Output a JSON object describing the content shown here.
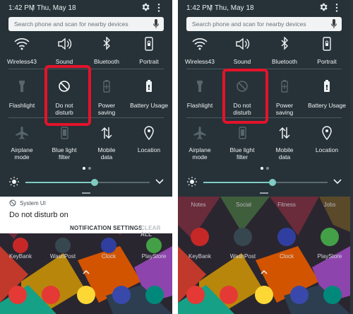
{
  "colors": {
    "panel": "#263238",
    "accent": "#80cbc4",
    "highlight": "#e3132a",
    "notification_bg": "#ffffff"
  },
  "screens": [
    {
      "status": {
        "time": "1:42 PM",
        "separator": "|",
        "date": "Thu, May 18"
      },
      "search": {
        "placeholder": "Search phone and scan for nearby devices"
      },
      "tiles": [
        {
          "label_lines": [
            "Wireless43",
            ""
          ],
          "icon": "wifi-icon"
        },
        {
          "label_lines": [
            "Sound",
            ""
          ],
          "icon": "volume-icon"
        },
        {
          "label_lines": [
            "Bluetooth",
            ""
          ],
          "icon": "bluetooth-icon"
        },
        {
          "label_lines": [
            "Portrait",
            ""
          ],
          "icon": "portrait-lock-icon"
        },
        {
          "label_lines": [
            "Flashlight",
            ""
          ],
          "icon": "flashlight-icon"
        },
        {
          "label_lines": [
            "Do not",
            "disturb"
          ],
          "icon": "do-not-disturb-icon"
        },
        {
          "label_lines": [
            "Power",
            "saving"
          ],
          "icon": "battery-saver-icon"
        },
        {
          "label_lines": [
            "Battery Usage",
            ""
          ],
          "icon": "battery-icon"
        },
        {
          "label_lines": [
            "Airplane",
            "mode"
          ],
          "icon": "airplane-icon"
        },
        {
          "label_lines": [
            "Blue light",
            "filter"
          ],
          "icon": "phone-icon"
        },
        {
          "label_lines": [
            "Mobile",
            "data"
          ],
          "icon": "mobile-data-icon"
        },
        {
          "label_lines": [
            "Location",
            ""
          ],
          "icon": "location-icon"
        }
      ],
      "dnd_state": "on",
      "page_indicator": {
        "pages": 2,
        "current": 1
      },
      "brightness_level": 0.58,
      "notification": {
        "app_name": "System UI",
        "title": "Do not disturb on",
        "action_primary": "NOTIFICATION SETTINGS",
        "action_secondary": "CLEAR ALL"
      },
      "apps": [
        {
          "label": "KeyBank",
          "color": "#c62828"
        },
        {
          "label": "WashPost",
          "color": "#37474f"
        },
        {
          "label": "Clock",
          "color": "#303f9f"
        },
        {
          "label": "PlayStore",
          "color": "#43a047"
        }
      ],
      "dock": [
        {
          "icon": "camera-icon",
          "color": "#e53935"
        },
        {
          "icon": "pocketcasts-icon",
          "color": "#e53935"
        },
        {
          "icon": "snapchat-icon",
          "color": "#fdd835"
        },
        {
          "icon": "browser-icon",
          "color": "#3949ab"
        },
        {
          "icon": "slides-icon",
          "color": "#00897b"
        }
      ]
    },
    {
      "status": {
        "time": "1:42 PM",
        "separator": "|",
        "date": "Thu, May 18"
      },
      "search": {
        "placeholder": "Search phone and scan for nearby devices"
      },
      "tiles": [
        {
          "label_lines": [
            "Wireless43",
            ""
          ],
          "icon": "wifi-icon"
        },
        {
          "label_lines": [
            "Sound",
            ""
          ],
          "icon": "volume-icon"
        },
        {
          "label_lines": [
            "Bluetooth",
            ""
          ],
          "icon": "bluetooth-icon"
        },
        {
          "label_lines": [
            "Portrait",
            ""
          ],
          "icon": "portrait-lock-icon"
        },
        {
          "label_lines": [
            "Flashlight",
            ""
          ],
          "icon": "flashlight-icon"
        },
        {
          "label_lines": [
            "Do not",
            "disturb"
          ],
          "icon": "do-not-disturb-icon"
        },
        {
          "label_lines": [
            "Power",
            "saving"
          ],
          "icon": "battery-saver-icon"
        },
        {
          "label_lines": [
            "Battery Usage",
            ""
          ],
          "icon": "battery-icon"
        },
        {
          "label_lines": [
            "Airplane",
            "mode"
          ],
          "icon": "airplane-icon"
        },
        {
          "label_lines": [
            "Blue light",
            "filter"
          ],
          "icon": "phone-icon"
        },
        {
          "label_lines": [
            "Mobile",
            "data"
          ],
          "icon": "mobile-data-icon"
        },
        {
          "label_lines": [
            "Location",
            ""
          ],
          "icon": "location-icon"
        }
      ],
      "dnd_state": "off",
      "page_indicator": {
        "pages": 2,
        "current": 1
      },
      "brightness_level": 0.58,
      "folder_labels": [
        "Notes",
        "Social",
        "Fitness",
        "Jobs"
      ],
      "apps": [
        {
          "label": "KeyBank",
          "color": "#c62828"
        },
        {
          "label": "WashPost",
          "color": "#37474f"
        },
        {
          "label": "Clock",
          "color": "#303f9f"
        },
        {
          "label": "PlayStore",
          "color": "#43a047"
        }
      ],
      "dock": [
        {
          "icon": "camera-icon",
          "color": "#e53935"
        },
        {
          "icon": "pocketcasts-icon",
          "color": "#e53935"
        },
        {
          "icon": "snapchat-icon",
          "color": "#fdd835"
        },
        {
          "icon": "browser-icon",
          "color": "#3949ab"
        },
        {
          "icon": "slides-icon",
          "color": "#00897b"
        }
      ]
    }
  ]
}
